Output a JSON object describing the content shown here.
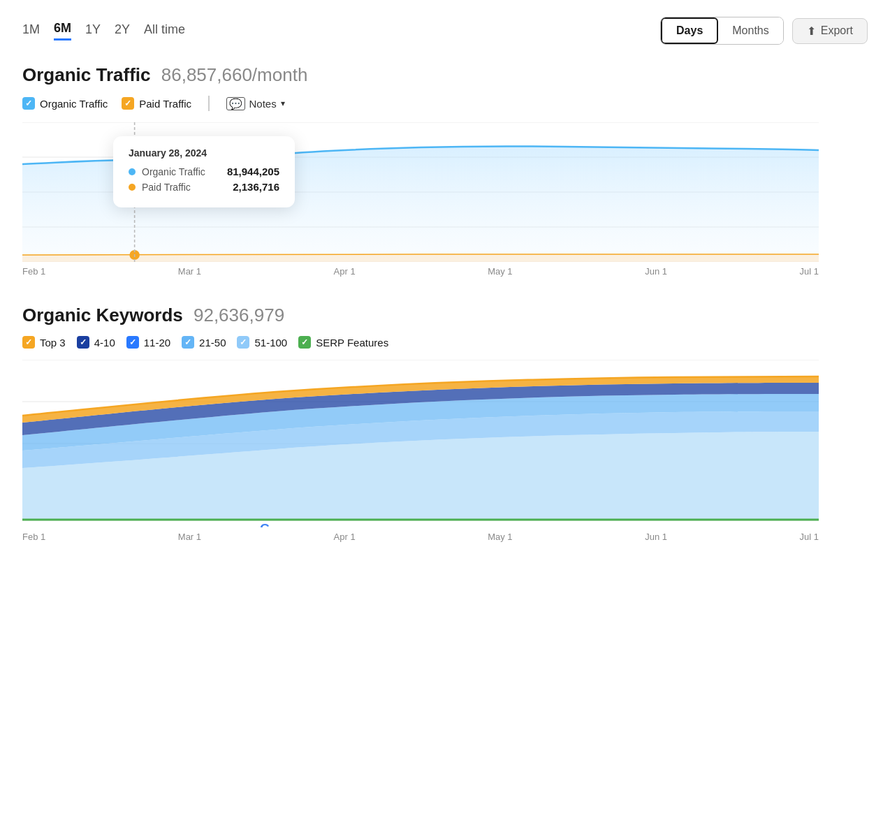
{
  "timeTabs": [
    {
      "label": "1M",
      "active": false
    },
    {
      "label": "6M",
      "active": true
    },
    {
      "label": "1Y",
      "active": false
    },
    {
      "label": "2Y",
      "active": false
    },
    {
      "label": "All time",
      "active": false
    }
  ],
  "toggleGroup": {
    "days": "Days",
    "months": "Months"
  },
  "exportBtn": "Export",
  "organicTraffic": {
    "title": "Organic Traffic",
    "value": "86,857,660/month"
  },
  "trafficLegend": [
    {
      "label": "Organic Traffic",
      "color": "#4db6f5",
      "checked": true
    },
    {
      "label": "Paid Traffic",
      "color": "#f5a623",
      "checked": true
    }
  ],
  "notesLabel": "Notes",
  "tooltip": {
    "date": "January 28, 2024",
    "rows": [
      {
        "label": "Organic Traffic",
        "value": "81,944,205",
        "color": "#4db6f5"
      },
      {
        "label": "Paid Traffic",
        "value": "2,136,716",
        "color": "#f5a623"
      }
    ]
  },
  "trafficYAxis": [
    "90.2M",
    "67.7M",
    "45.1M",
    "22.6M",
    "0"
  ],
  "trafficXAxis": [
    "Feb 1",
    "Mar 1",
    "Apr 1",
    "May 1",
    "Jun 1",
    "Jul 1"
  ],
  "organicKeywords": {
    "title": "Organic Keywords",
    "value": "92,636,979"
  },
  "kwLegend": [
    {
      "label": "Top 3",
      "color": "#f5a623",
      "checked": true,
      "opacity": 1
    },
    {
      "label": "4-10",
      "color": "#1a3fa0",
      "checked": true,
      "opacity": 1
    },
    {
      "label": "11-20",
      "color": "#2979ff",
      "checked": true,
      "opacity": 1
    },
    {
      "label": "21-50",
      "color": "#64b5f6",
      "checked": true,
      "opacity": 0.7
    },
    {
      "label": "51-100",
      "color": "#90caf9",
      "checked": true,
      "opacity": 0.5
    },
    {
      "label": "SERP Features",
      "color": "#4caf50",
      "checked": true,
      "opacity": 1
    }
  ],
  "kwYAxis": [
    "93.4M",
    "70M",
    "46.7M",
    "23.3M",
    "0"
  ],
  "kwXAxis": [
    "Feb 1",
    "Mar 1",
    "Apr 1",
    "May 1",
    "Jun 1",
    "Jul 1"
  ]
}
